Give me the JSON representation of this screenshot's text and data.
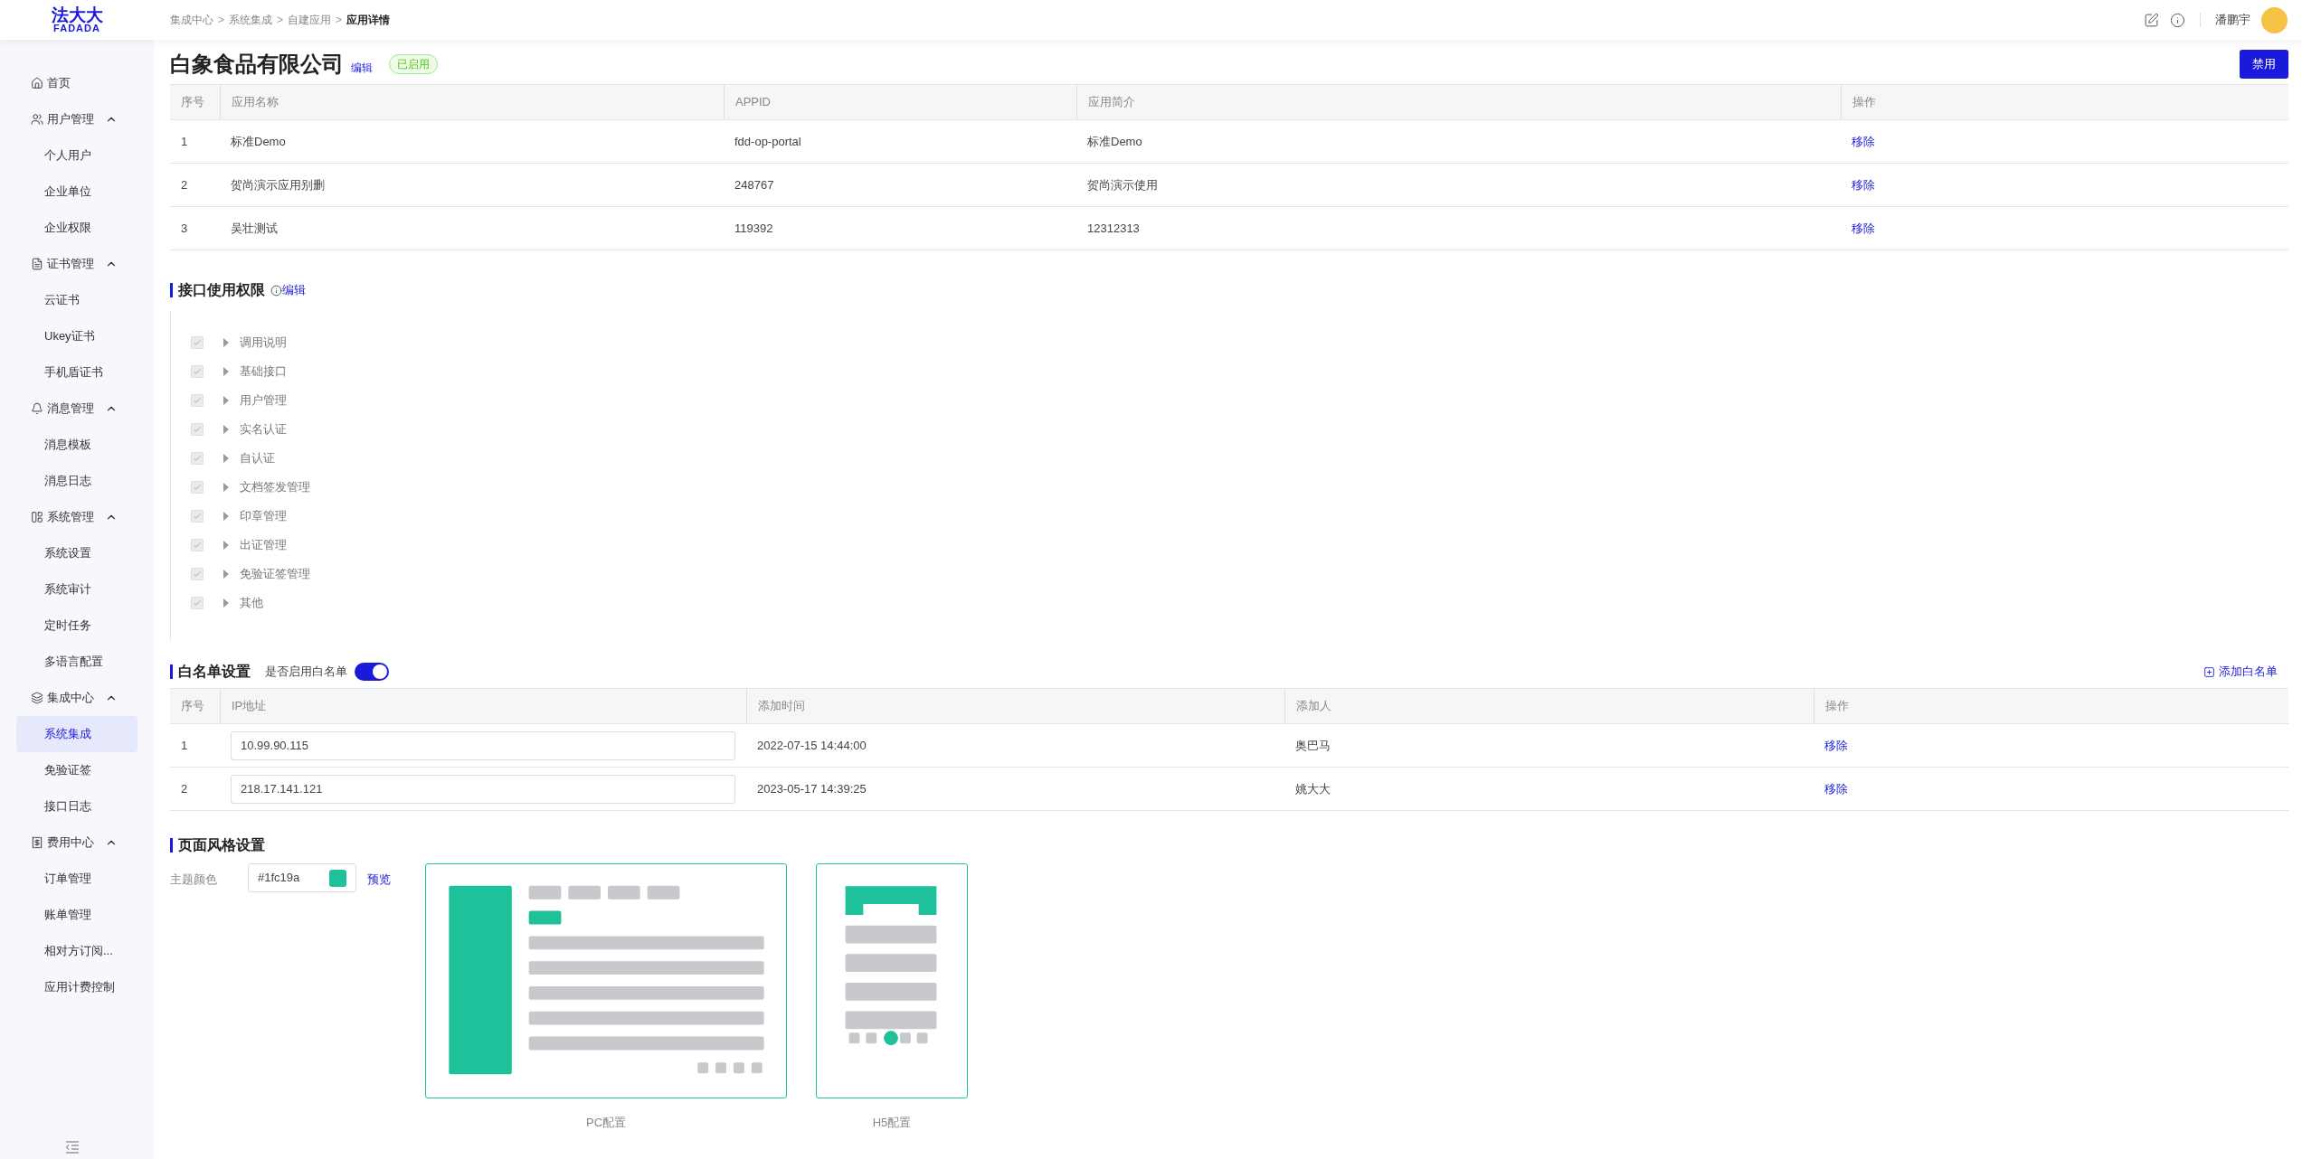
{
  "logo": {
    "cn": "法大大",
    "en": "FADADA"
  },
  "breadcrumb": {
    "separator": ">",
    "items": [
      "集成中心",
      "系统集成",
      "自建应用",
      "应用详情"
    ]
  },
  "user": {
    "name": "潘鹏宇"
  },
  "sidebar": {
    "items": [
      {
        "label": "首页",
        "selected": false
      },
      {
        "label": "用户管理",
        "expanded": true,
        "children": [
          {
            "label": "个人用户",
            "selected": false
          },
          {
            "label": "企业单位",
            "selected": false
          },
          {
            "label": "企业权限",
            "selected": false
          }
        ]
      },
      {
        "label": "证书管理",
        "expanded": true,
        "children": [
          {
            "label": "云证书",
            "selected": false
          },
          {
            "label": "Ukey证书",
            "selected": false
          },
          {
            "label": "手机盾证书",
            "selected": false
          }
        ]
      },
      {
        "label": "消息管理",
        "expanded": true,
        "children": [
          {
            "label": "消息模板",
            "selected": false
          },
          {
            "label": "消息日志",
            "selected": false
          }
        ]
      },
      {
        "label": "系统管理",
        "expanded": true,
        "children": [
          {
            "label": "系统设置",
            "selected": false
          },
          {
            "label": "系统审计",
            "selected": false
          },
          {
            "label": "定时任务",
            "selected": false
          },
          {
            "label": "多语言配置",
            "selected": false
          }
        ]
      },
      {
        "label": "集成中心",
        "expanded": true,
        "children": [
          {
            "label": "系统集成",
            "selected": true
          },
          {
            "label": "免验证签",
            "selected": false
          },
          {
            "label": "接口日志",
            "selected": false
          }
        ]
      },
      {
        "label": "费用中心",
        "expanded": true,
        "children": [
          {
            "label": "订单管理",
            "selected": false
          },
          {
            "label": "账单管理",
            "selected": false
          },
          {
            "label": "相对方订阅...",
            "selected": false
          },
          {
            "label": "应用计费控制",
            "selected": false
          }
        ]
      }
    ]
  },
  "page": {
    "title": "白象食品有限公司",
    "edit": "编辑",
    "status": "已启用",
    "disable_button": "禁用"
  },
  "apps_table": {
    "columns": [
      "序号",
      "应用名称",
      "APPID",
      "应用简介",
      "操作"
    ],
    "rows": [
      [
        "1",
        "标准Demo",
        "fdd-op-portal",
        "标准Demo",
        "移除"
      ],
      [
        "2",
        "贺尚演示应用别删",
        "248767",
        "贺尚演示使用",
        "移除"
      ],
      [
        "3",
        "吴壮测试",
        "119392",
        "12312313",
        "移除"
      ]
    ]
  },
  "permissions": {
    "title": "接口使用权限",
    "edit": "编辑",
    "items": [
      {
        "label": "调用说明",
        "checked": true,
        "expanded": false
      },
      {
        "label": "基础接口",
        "checked": true,
        "expanded": false
      },
      {
        "label": "用户管理",
        "checked": true,
        "expanded": false
      },
      {
        "label": "实名认证",
        "checked": true,
        "expanded": false
      },
      {
        "label": "自认证",
        "checked": true,
        "expanded": false
      },
      {
        "label": "文档签发管理",
        "checked": true,
        "expanded": false
      },
      {
        "label": "印章管理",
        "checked": true,
        "expanded": false
      },
      {
        "label": "出证管理",
        "checked": true,
        "expanded": false
      },
      {
        "label": "免验证签管理",
        "checked": true,
        "expanded": false
      },
      {
        "label": "其他",
        "checked": true,
        "expanded": false
      }
    ]
  },
  "whitelist": {
    "title": "白名单设置",
    "toggle_label": "是否启用白名单",
    "on": true,
    "add": "添加白名单",
    "columns": [
      "序号",
      "IP地址",
      "添加时间",
      "添加人",
      "操作"
    ],
    "rows": [
      {
        "no": "1",
        "ip": "10.99.90.115",
        "time": "2022-07-15 14:44:00",
        "by": "奥巴马",
        "action": "移除"
      },
      {
        "no": "2",
        "ip": "218.17.141.121",
        "time": "2023-05-17 14:39:25",
        "by": "姚大大",
        "action": "移除"
      }
    ]
  },
  "style": {
    "title": "页面风格设置",
    "color_label": "主题颜色",
    "color_value": "#1fc19a",
    "preview": "预览",
    "pc_label": "PC配置",
    "h5_label": "H5配置"
  }
}
